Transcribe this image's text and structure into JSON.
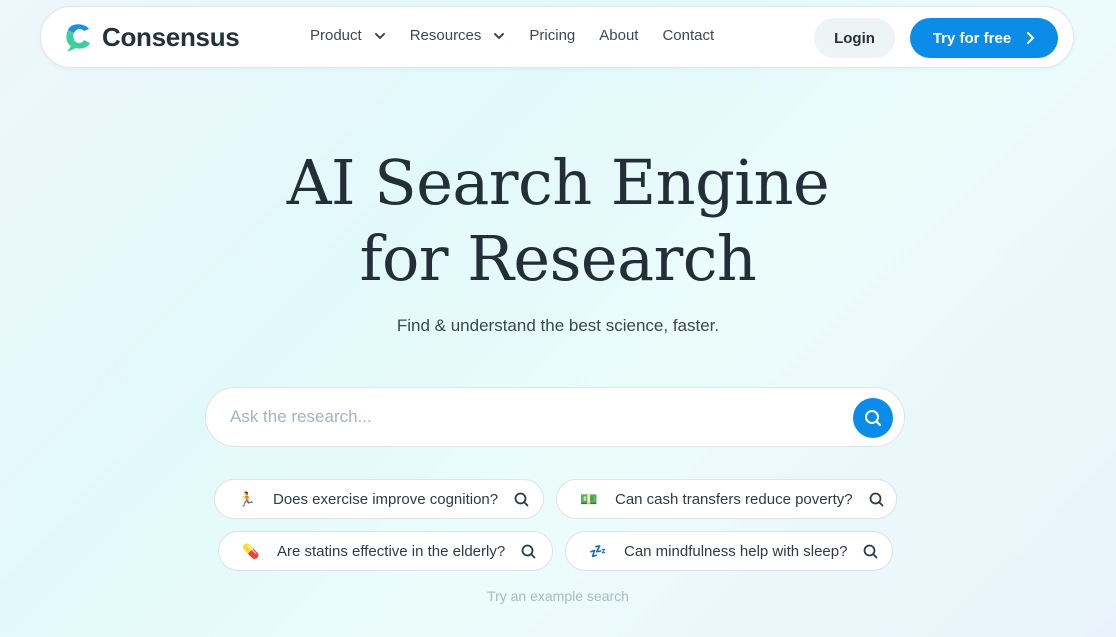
{
  "nav": {
    "brand": "Consensus",
    "menu": [
      {
        "label": "Product",
        "has_dropdown": true
      },
      {
        "label": "Resources",
        "has_dropdown": true
      },
      {
        "label": "Pricing",
        "has_dropdown": false
      },
      {
        "label": "About",
        "has_dropdown": false
      },
      {
        "label": "Contact",
        "has_dropdown": false
      }
    ],
    "login_label": "Login",
    "cta_label": "Try for free"
  },
  "hero": {
    "title_line1": "AI Search Engine",
    "title_line2": "for Research",
    "subtitle": "Find & understand the best science, faster."
  },
  "search": {
    "placeholder": "Ask the research...",
    "value": ""
  },
  "examples": [
    {
      "emoji": "🏃",
      "icon": "running-person-icon",
      "label": "Does exercise improve cognition?"
    },
    {
      "emoji": "💵",
      "icon": "cash-icon",
      "label": "Can cash transfers reduce poverty?"
    },
    {
      "emoji": "💊",
      "icon": "pill-icon",
      "label": "Are statins effective in the elderly?"
    },
    {
      "emoji": "💤",
      "icon": "sleep-icon",
      "label": "Can mindfulness help with sleep?"
    }
  ],
  "example_hint": "Try an example search",
  "colors": {
    "accent": "#0b8ce9",
    "logo_blue": "#1a8fe3",
    "logo_green": "#3ccf9e",
    "text_dark": "#232e38"
  }
}
